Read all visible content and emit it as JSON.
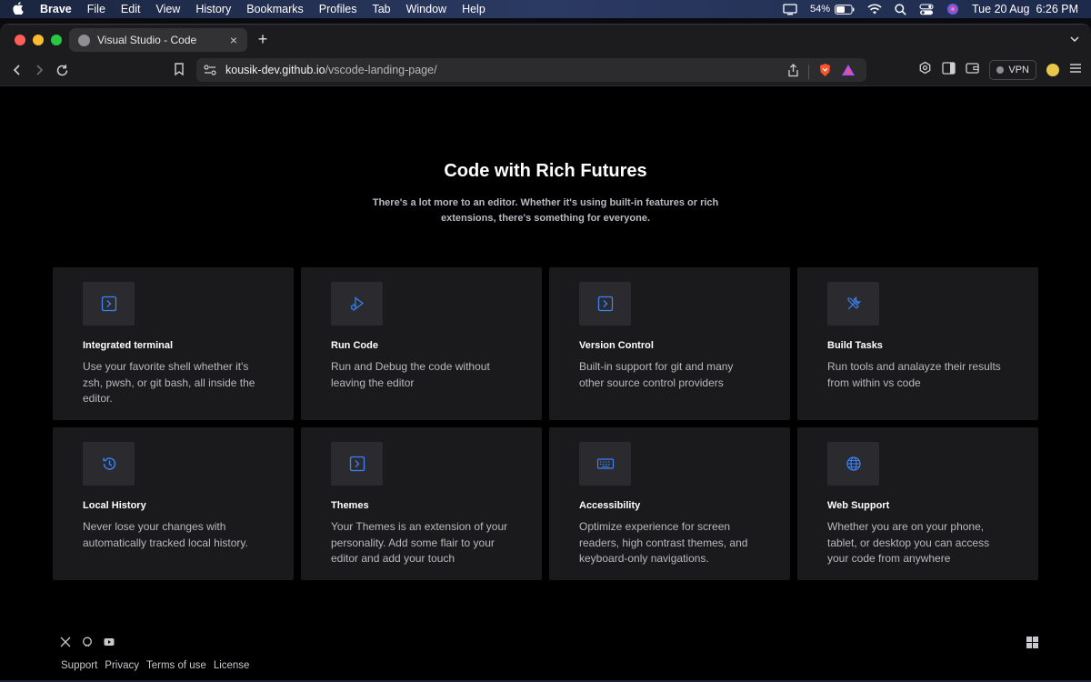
{
  "menubar": {
    "app_name": "Brave",
    "items": [
      "File",
      "Edit",
      "View",
      "History",
      "Bookmarks",
      "Profiles",
      "Tab",
      "Window",
      "Help"
    ],
    "battery_percent": "54%",
    "datetime": "Tue 20 Aug  6:26 PM"
  },
  "browser": {
    "tab_title": "Visual Studio - Code",
    "url_domain": "kousik-dev.github.io",
    "url_path": "/vscode-landing-page/",
    "vpn_label": "VPN"
  },
  "page": {
    "heading": "Code with Rich Futures",
    "subheading": "There's a lot more to an editor. Whether it's using built-in features or rich extensions, there's something for everyone.",
    "accent_color": "#3b82f6",
    "features": [
      {
        "icon": "terminal-icon",
        "title": "Integrated terminal",
        "description": "Use your favorite shell whether it's zsh, pwsh, or git bash, all inside the editor."
      },
      {
        "icon": "run-code-icon",
        "title": "Run Code",
        "description": "Run and Debug the code without leaving the editor"
      },
      {
        "icon": "version-control-icon",
        "title": "Version Control",
        "description": "Built-in support for git and many other source control providers"
      },
      {
        "icon": "build-tools-icon",
        "title": "Build Tasks",
        "description": "Run tools and analayze their results from within vs code"
      },
      {
        "icon": "history-icon",
        "title": "Local History",
        "description": "Never lose your changes with automatically tracked local history."
      },
      {
        "icon": "themes-icon",
        "title": "Themes",
        "description": "Your Themes is an extension of your personality. Add some flair to your editor and add your touch"
      },
      {
        "icon": "keyboard-icon",
        "title": "Accessibility",
        "description": "Optimize experience for screen readers, high contrast themes, and keyboard-only navigations."
      },
      {
        "icon": "globe-icon",
        "title": "Web Support",
        "description": "Whether you are on your phone, tablet, or desktop you can access your code from anywhere"
      }
    ]
  },
  "footer": {
    "social_icons": [
      "x-twitter-icon",
      "github-icon",
      "youtube-icon"
    ],
    "links": [
      "Support",
      "Privacy",
      "Terms of use",
      "License"
    ]
  }
}
